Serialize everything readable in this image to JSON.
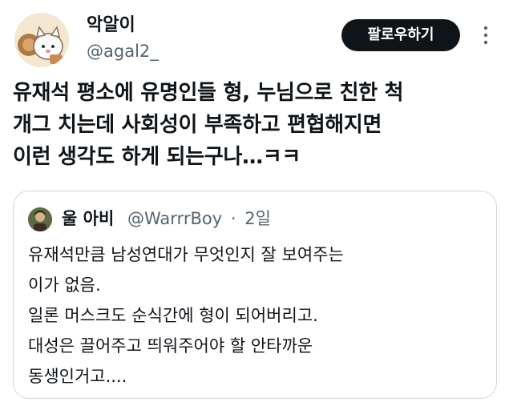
{
  "author": {
    "display_name": "악알이",
    "handle": "@agal2_"
  },
  "follow_button_label": "팔로우하기",
  "tweet_lines": [
    "유재석 평소에 유명인들 형, 누님으로 친한 척",
    "개그 치는데 사회성이 부족하고 편협해지면",
    "이런 생각도 하게 되는구나…ㅋㅋ"
  ],
  "quoted": {
    "display_name": "울 아비",
    "handle": "@WarrrBoy",
    "separator": "·",
    "time": "2일",
    "lines": [
      "유재석만큼 남성연대가 무엇인지 잘 보여주는",
      "이가 없음.",
      "일론 머스크도 순식간에 형이 되어버리고.",
      "대성은 끌어주고 띄워주어야 할 안타까운",
      "동생인거고...."
    ]
  }
}
